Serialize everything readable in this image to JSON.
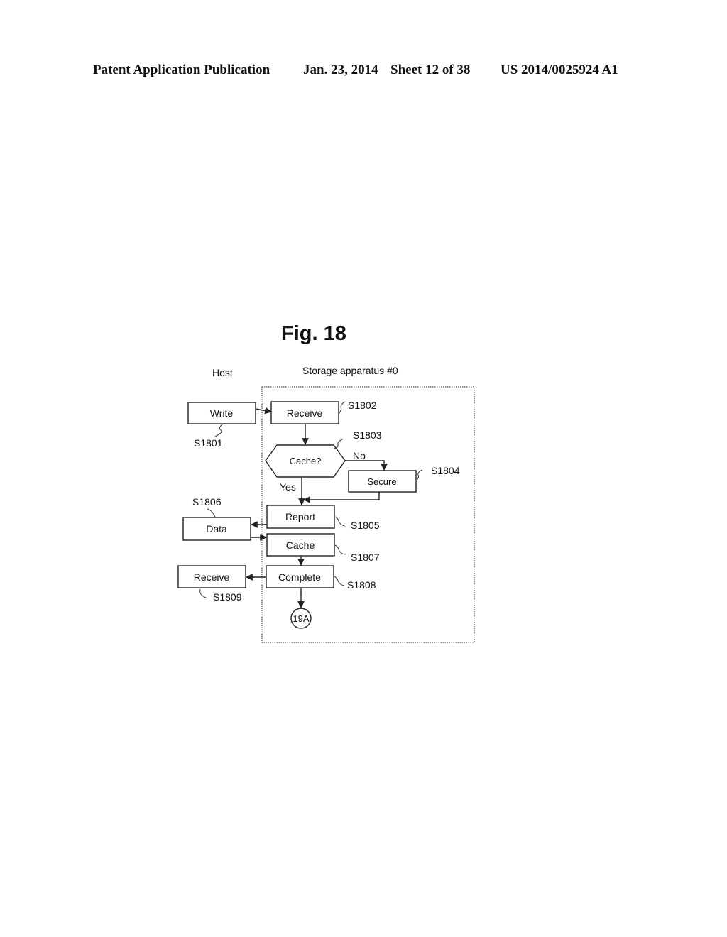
{
  "header": {
    "publication": "Patent Application Publication",
    "date": "Jan. 23, 2014",
    "sheet": "Sheet 12 of 38",
    "number": "US 2014/0025924 A1"
  },
  "figure": {
    "title": "Fig. 18",
    "lanes": {
      "host": "Host",
      "storage": "Storage apparatus #0"
    },
    "nodes": {
      "write": {
        "label": "Write",
        "step": "S1801"
      },
      "receive_storage": {
        "label": "Receive",
        "step": "S1802"
      },
      "cache_decision": {
        "label": "Cache?",
        "step": "S1803",
        "yes": "Yes",
        "no": "No"
      },
      "secure": {
        "label": "Secure",
        "step": "S1804"
      },
      "report": {
        "label": "Report",
        "step": "S1805"
      },
      "data": {
        "label": "Data",
        "step": "S1806"
      },
      "cache": {
        "label": "Cache",
        "step": "S1807"
      },
      "complete": {
        "label": "Complete",
        "step": "S1808"
      },
      "receive_host": {
        "label": "Receive",
        "step": "S1809"
      },
      "connector": {
        "label": "19A"
      }
    }
  }
}
